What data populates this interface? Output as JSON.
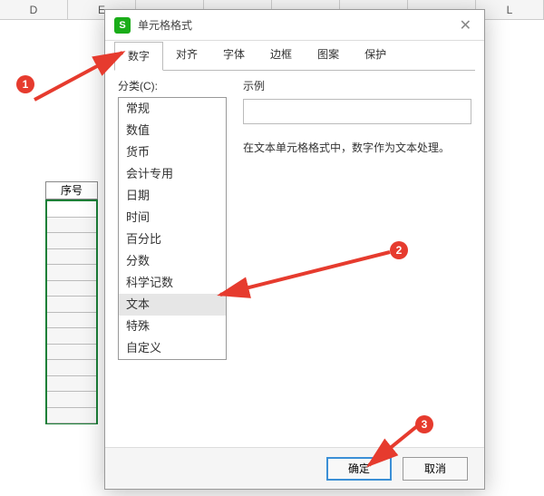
{
  "sheet": {
    "columns": [
      "D",
      "E",
      "",
      "",
      "",
      "",
      "",
      "L"
    ],
    "seq_header": "序号"
  },
  "dialog": {
    "title": "单元格格式",
    "tabs": [
      "数字",
      "对齐",
      "字体",
      "边框",
      "图案",
      "保护"
    ],
    "active_tab": 0,
    "category_label": "分类(C):",
    "categories": [
      "常规",
      "数值",
      "货币",
      "会计专用",
      "日期",
      "时间",
      "百分比",
      "分数",
      "科学记数",
      "文本",
      "特殊",
      "自定义"
    ],
    "selected_category_index": 9,
    "sample_label": "示例",
    "description": "在文本单元格格式中，数字作为文本处理。",
    "ok_label": "确定",
    "cancel_label": "取消"
  },
  "callouts": {
    "1": "1",
    "2": "2",
    "3": "3"
  }
}
